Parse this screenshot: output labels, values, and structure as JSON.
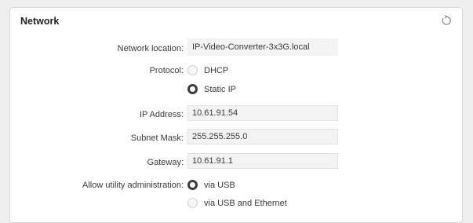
{
  "section": {
    "title": "Network",
    "reset_icon": "reset-arrow-icon"
  },
  "network_location": {
    "label": "Network location:",
    "value": "IP-Video-Converter-3x3G.local"
  },
  "protocol": {
    "label": "Protocol:",
    "options": [
      {
        "label": "DHCP",
        "selected": false
      },
      {
        "label": "Static IP",
        "selected": true
      }
    ]
  },
  "ip_address": {
    "label": "IP Address:",
    "value": "10.61.91.54"
  },
  "subnet_mask": {
    "label": "Subnet Mask:",
    "value": "255.255.255.0"
  },
  "gateway": {
    "label": "Gateway:",
    "value": "10.61.91.1"
  },
  "utility_admin": {
    "label": "Allow utility administration:",
    "options": [
      {
        "label": "via USB",
        "selected": true
      },
      {
        "label": "via USB and Ethernet",
        "selected": false
      }
    ]
  }
}
